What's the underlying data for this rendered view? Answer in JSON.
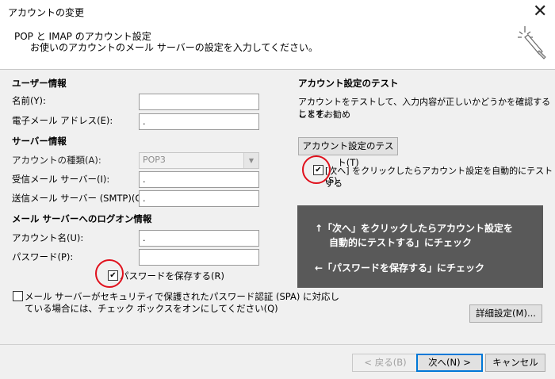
{
  "window": {
    "title": "アカウントの変更",
    "close_glyph": "✕"
  },
  "header": {
    "title": "POP と IMAP のアカウント設定",
    "subtitle": "お使いのアカウントのメール サーバーの設定を入力してください。",
    "icon": "wizard-wand-icon"
  },
  "user_info": {
    "section_label": "ユーザー情報",
    "name_label": "名前(Y):",
    "name_value": "",
    "email_label": "電子メール アドレス(E):",
    "email_value": "."
  },
  "server_info": {
    "section_label": "サーバー情報",
    "account_type_label": "アカウントの種類(A):",
    "account_type_value": "POP3",
    "incoming_label": "受信メール サーバー(I):",
    "incoming_value": ".",
    "outgoing_label": "送信メール サーバー (SMTP)(O):",
    "outgoing_value": "."
  },
  "logon_info": {
    "section_label": "メール サーバーへのログオン情報",
    "account_name_label": "アカウント名(U):",
    "account_name_value": ".",
    "password_label": "パスワード(P):",
    "password_value": "",
    "save_password_label": "パスワードを保存する(R)",
    "save_password_checked": true,
    "spa_label_line1": "メール サーバーがセキュリティで保護されたパスワード認証 (SPA) に対応し",
    "spa_label_line2": "ている場合には、チェック ボックスをオンにしてください(Q)",
    "spa_checked": false
  },
  "test": {
    "section_label": "アカウント設定のテスト",
    "description_line1": "アカウントをテストして、入力内容が正しいかどうかを確認することをお勧め",
    "description_line2": "します。",
    "test_button": "アカウント設定のテスト(T)",
    "auto_test_line1": "[次へ] をクリックしたらアカウント設定を自動的にテストする",
    "auto_test_line2": "(S)",
    "auto_test_checked": true
  },
  "note": {
    "line1": "↑「次へ」をクリックしたらアカウント設定を",
    "line2": "自動的にテストする」にチェック",
    "line3": "←「パスワードを保存する」にチェック"
  },
  "buttons": {
    "advanced": "詳細設定(M)...",
    "back": "< 戻る(B)",
    "next": "次へ(N) >",
    "cancel": "キャンセル"
  },
  "colors": {
    "highlight_circle": "#e0101c",
    "note_bg": "#595959",
    "accent": "#0078d7"
  }
}
